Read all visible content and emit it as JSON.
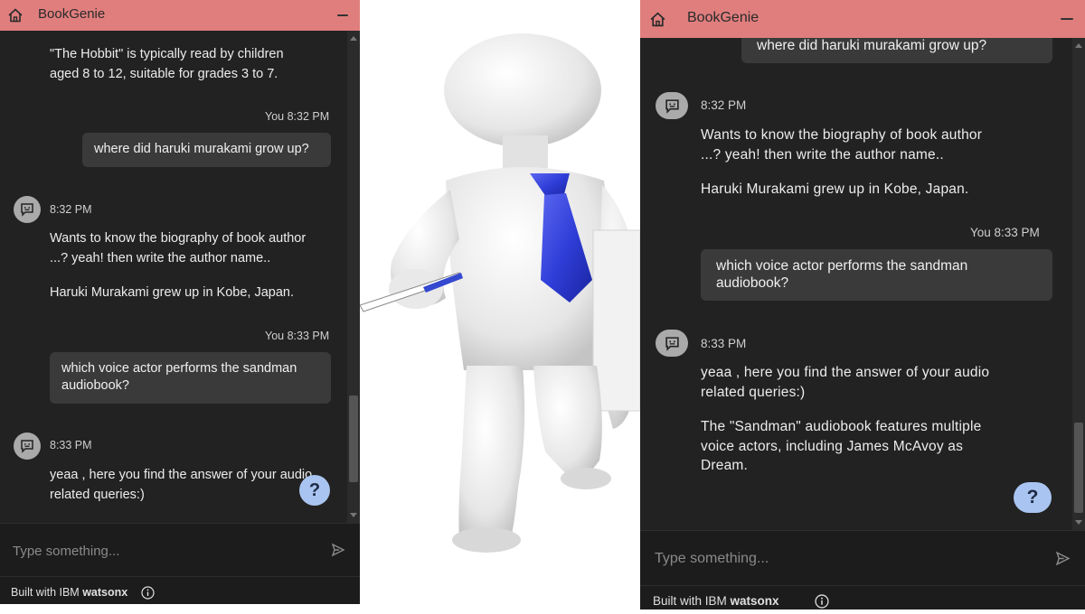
{
  "app": {
    "title": "BookGenie"
  },
  "left_panel": {
    "messages": [
      {
        "role": "bot",
        "text": "\"The Hobbit\" is typically read by children\naged 8 to 12, suitable for grades 3 to 7."
      },
      {
        "role": "user",
        "time": "You 8:32 PM",
        "text": "where did haruki murakami grow up?"
      },
      {
        "role": "bot",
        "time": "8:32 PM",
        "paragraphs": [
          "Wants to know the biography of book author\n...? yeah! then write the author name..",
          "Haruki Murakami grew up in Kobe, Japan."
        ]
      },
      {
        "role": "user",
        "time": "You 8:33 PM",
        "text": "which voice actor performs the sandman\naudiobook?"
      },
      {
        "role": "bot",
        "time": "8:33 PM",
        "paragraphs": [
          "yeaa , here you find the answer of your audio\nrelated queries:)"
        ]
      }
    ]
  },
  "right_panel": {
    "messages": [
      {
        "role": "user",
        "text": "where did haruki murakami grow up?"
      },
      {
        "role": "bot",
        "time": "8:32 PM",
        "paragraphs": [
          "Wants to know the biography of book author\n...? yeah! then write the author name..",
          "Haruki Murakami grew up in Kobe, Japan."
        ]
      },
      {
        "role": "user",
        "time": "You 8:33 PM",
        "text": "which voice actor performs the sandman\naudiobook?"
      },
      {
        "role": "bot",
        "time": "8:33 PM",
        "paragraphs": [
          "yeaa , here you find the answer of your audio\nrelated queries:)",
          "The \"Sandman\" audiobook features multiple\nvoice actors, including James McAvoy as\nDream."
        ]
      }
    ]
  },
  "input": {
    "placeholder": "Type something..."
  },
  "help_button": {
    "label": "?"
  },
  "footer": {
    "text_prefix": "Built with IBM ",
    "text_brand": "watsonx"
  },
  "colors": {
    "header": "#e07e7e",
    "panel_bg": "#222222",
    "bubble": "#3a3a3a",
    "help": "#a9c4f0",
    "tie": "#2f3ed8"
  },
  "icons": {
    "home": "home-icon",
    "minimize": "minimize-icon",
    "bot_avatar": "chat-bot-icon",
    "send": "send-icon",
    "info": "info-icon"
  }
}
